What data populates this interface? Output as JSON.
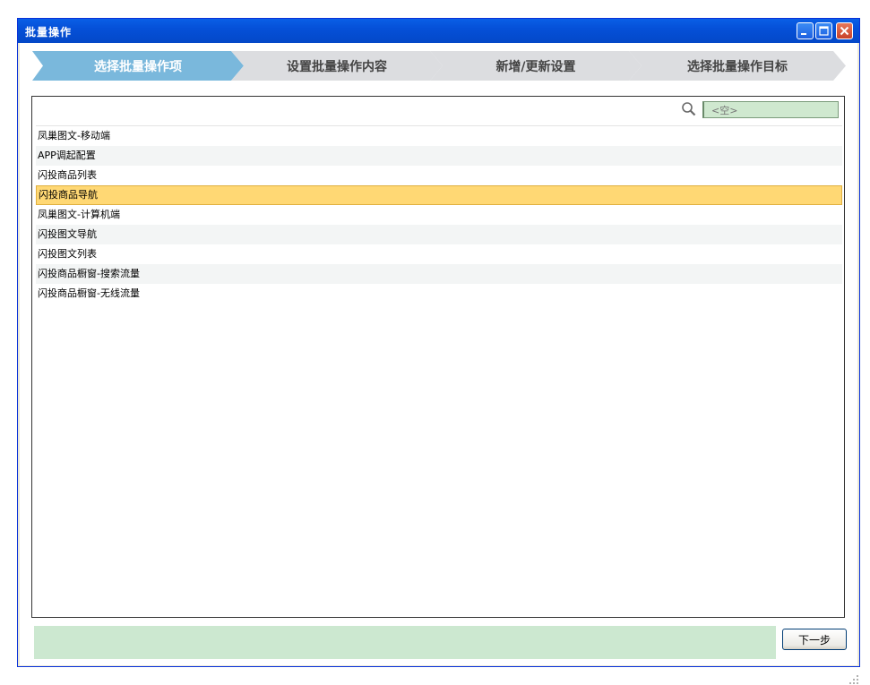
{
  "window": {
    "title": "批量操作"
  },
  "steps": [
    {
      "label": "选择批量操作项",
      "active": true
    },
    {
      "label": "设置批量操作内容",
      "active": false
    },
    {
      "label": "新增/更新设置",
      "active": false
    },
    {
      "label": "选择批量操作目标",
      "active": false
    }
  ],
  "search": {
    "placeholder": "<空>",
    "value": ""
  },
  "items": [
    {
      "label": "凤巢图文-移动端"
    },
    {
      "label": "APP调起配置"
    },
    {
      "label": "闪投商品列表"
    },
    {
      "label": "闪投商品导航",
      "selected": true
    },
    {
      "label": "凤巢图文-计算机端"
    },
    {
      "label": "闪投图文导航"
    },
    {
      "label": "闪投图文列表"
    },
    {
      "label": "闪投商品橱窗-搜索流量"
    },
    {
      "label": "闪投商品橱窗-无线流量"
    }
  ],
  "footer": {
    "next_label": "下一步"
  },
  "colors": {
    "active_step": "#7ab8dc",
    "inactive_step": "#dcdde0",
    "selected_row": "#ffd874",
    "status_bar": "#cce8d0"
  },
  "icons": {
    "search": "magnifier-icon",
    "minimize": "minimize-icon",
    "maximize": "maximize-icon",
    "close": "close-icon"
  }
}
